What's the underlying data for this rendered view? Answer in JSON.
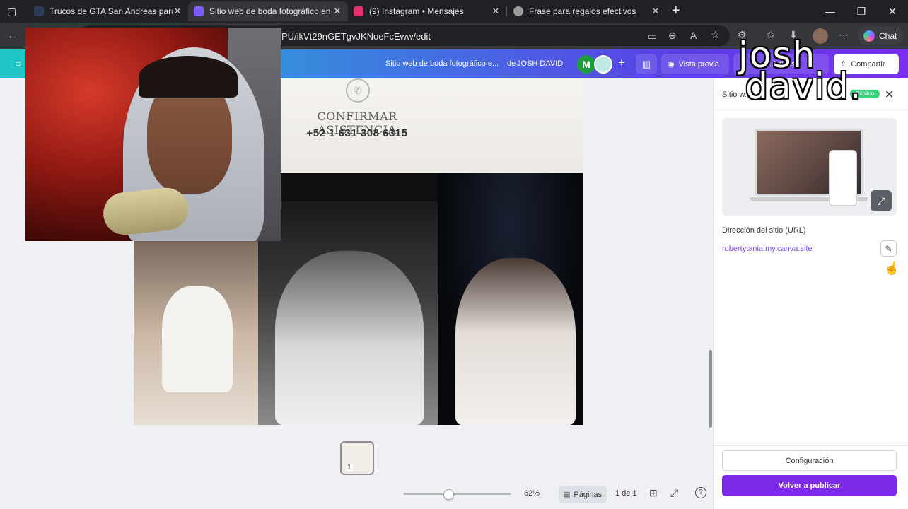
{
  "browser": {
    "tabs": [
      {
        "title": "Trucos de GTA San Andreas para P",
        "close": "✕",
        "favicon_color": "#2f3a55"
      },
      {
        "title": "Sitio web de boda fotográfico en",
        "close": "✕",
        "favicon_color": "#7b5cff",
        "active": true
      },
      {
        "title": "(9) Instagram • Mensajes",
        "close": "✕",
        "favicon_color": "#e1306c"
      },
      {
        "title": "Frase para regalos efectivos",
        "close": "✕",
        "favicon_color": "#9a9a9a"
      }
    ],
    "new_tab": "+",
    "url": "PU/ikVt29nGETgvJKNoeFcEww/edit",
    "chat_label": "Chat"
  },
  "header": {
    "doc_title": "Sitio web de boda fotográfico e...",
    "owner_prefix": "de",
    "owner_name": "JOSH DAVID",
    "avatar_letter": "M",
    "add_label": "+",
    "preview_label": "Vista previa",
    "analytics_label": "...icticas",
    "share_label": "Compartir"
  },
  "canvas": {
    "rsvp_title": "CONFIRMAR ASISTENCIA",
    "rsvp_phone": "+52 1 631 308 6315",
    "page_thumb_label": "1"
  },
  "toolbar": {
    "zoom_level": "62%",
    "zoom_fraction": 0.42,
    "pages_label": "Páginas",
    "page_count": "1 de 1"
  },
  "panel": {
    "title": "Sitio w...",
    "badge": "Público",
    "url_label": "Dirección del sitio (URL)",
    "site_url": "robertytania.my.canva.site",
    "settings_label": "Configuración",
    "republish_label": "Volver a publicar"
  },
  "watermark": {
    "line1": "josh",
    "line2": "david."
  },
  "colors": {
    "accent": "#7d2ae8",
    "header_start": "#1fc8c6",
    "header_end": "#7b2ff0",
    "public_badge": "#39d27c",
    "link": "#7a4dff"
  }
}
